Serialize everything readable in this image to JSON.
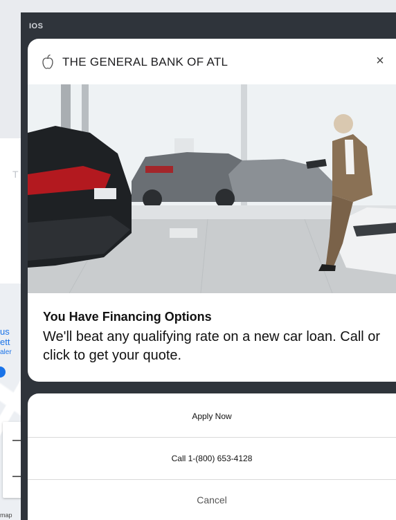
{
  "background": {
    "map_text_line1": "us",
    "map_text_line2": "ett",
    "map_text_line3": "aler",
    "map_attribution": "map"
  },
  "preview": {
    "os_label": "IOS",
    "notification": {
      "app_name": "THE GENERAL BANK OF ATL",
      "close_symbol": "×",
      "title": "You Have Financing Options",
      "body": "We'll beat any qualifying rate on a new car loan. Call or click to get your quote."
    },
    "actions": [
      {
        "label": "Apply Now"
      },
      {
        "label": "Call 1-(800) 653-4128"
      },
      {
        "label": "Cancel"
      }
    ]
  },
  "colors": {
    "panel": "#2f343b",
    "card": "#ffffff",
    "map_blue": "#1a73e8"
  },
  "icons": [
    "apple-icon",
    "close-icon"
  ]
}
